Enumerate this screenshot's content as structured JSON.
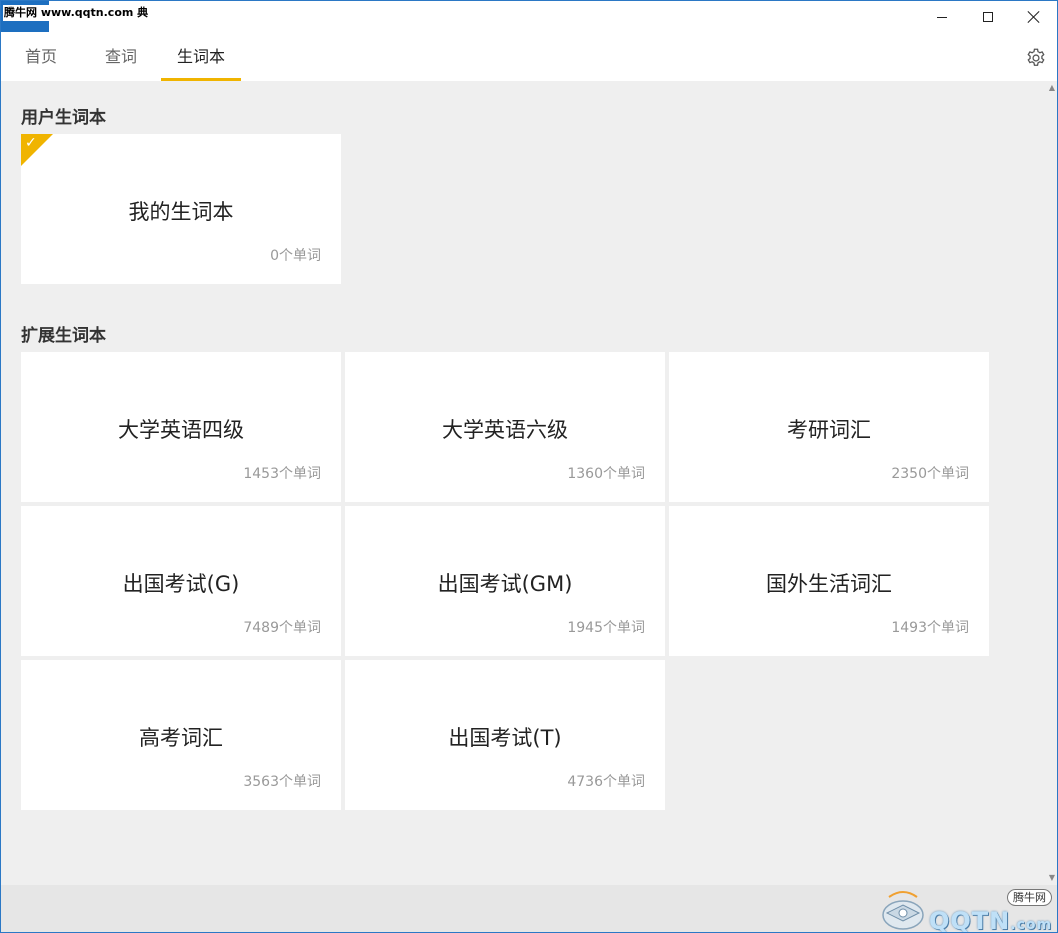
{
  "watermark": {
    "top_text": "腾牛网 www.qqtn.com 典",
    "bottom_site": "腾牛网",
    "bottom_logo": "QQTN",
    "bottom_logo_suffix": ".com"
  },
  "tabs": [
    {
      "label": "首页",
      "active": false
    },
    {
      "label": "查词",
      "active": false
    },
    {
      "label": "生词本",
      "active": true
    }
  ],
  "user_section": {
    "title": "用户生词本",
    "books": [
      {
        "name": "我的生词本",
        "count": "0个单词",
        "selected": true
      }
    ]
  },
  "extended_section": {
    "title": "扩展生词本",
    "books": [
      {
        "name": "大学英语四级",
        "count": "1453个单词"
      },
      {
        "name": "大学英语六级",
        "count": "1360个单词"
      },
      {
        "name": "考研词汇",
        "count": "2350个单词"
      },
      {
        "name": "出国考试(G)",
        "count": "7489个单词"
      },
      {
        "name": "出国考试(GM)",
        "count": "1945个单词"
      },
      {
        "name": "国外生活词汇",
        "count": "1493个单词"
      },
      {
        "name": "高考词汇",
        "count": "3563个单词"
      },
      {
        "name": "出国考试(T)",
        "count": "4736个单词"
      }
    ]
  },
  "icons": {
    "settings": "gear-icon",
    "selected": "checkmark-icon"
  },
  "colors": {
    "accent": "#f0b400",
    "background": "#efefef",
    "card": "#ffffff",
    "window_border": "#2b78c5"
  }
}
